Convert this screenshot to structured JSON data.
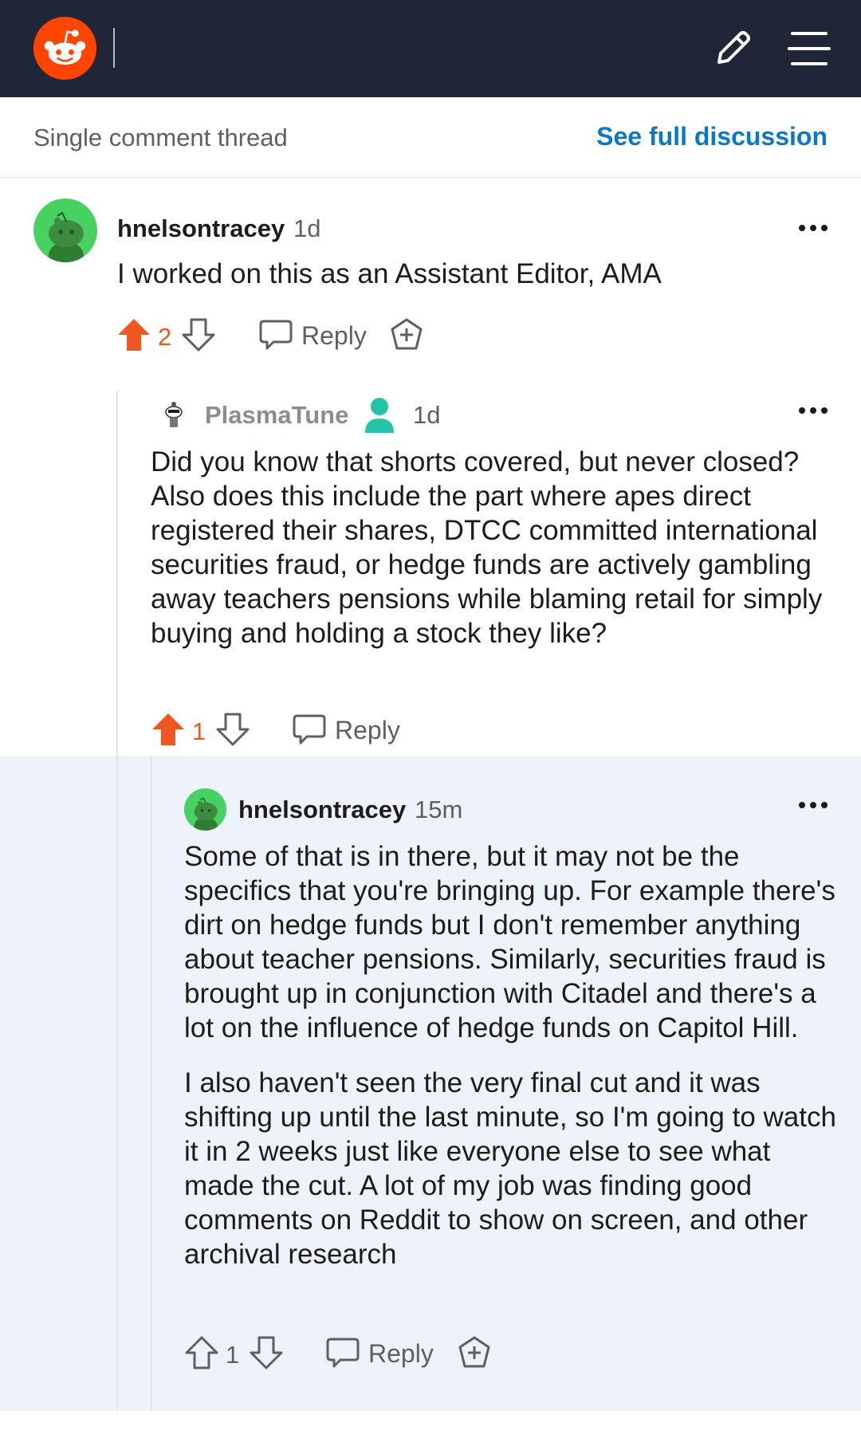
{
  "topbar": {
    "logo_icon": "reddit-snoo-logo",
    "edit_icon": "pencil-icon",
    "menu_icon": "hamburger-menu-icon",
    "colors": {
      "bar": "#1f2638",
      "logo": "#ff4500"
    }
  },
  "subheader": {
    "title": "Single comment thread",
    "link": "See full discussion"
  },
  "comments": [
    {
      "username": "hnelsontracey",
      "time": "1d",
      "paragraphs": [
        "I worked on this as an Assistant Editor, AMA"
      ],
      "score": "2",
      "vote_state": "upvoted",
      "reply_label": "Reply"
    },
    {
      "username": "PlasmaTune",
      "time": "1d",
      "paragraphs": [
        "Did you know that shorts covered, but never closed? Also does this include the part where apes direct registered their shares, DTCC committed international securities fraud, or hedge funds are actively gambling away teachers pensions while blaming retail for simply buying and holding a stock they like?"
      ],
      "score": "1",
      "vote_state": "upvoted",
      "reply_label": "Reply"
    },
    {
      "username": "hnelsontracey",
      "time": "15m",
      "paragraphs": [
        "Some of that is in there, but it may not be the specifics that you're bringing up. For example there's dirt on hedge funds but I don't remember anything about teacher pensions. Similarly, securities fraud is brought up in conjunction with Citadel and there's a lot on the influence of hedge funds on Capitol Hill.",
        "I also haven't seen the very final cut and it was shifting up until the last minute, so I'm going to watch it in 2 weeks just like everyone else to see what made the cut. A lot of my job was finding good comments on Reddit to show on screen, and other archival research"
      ],
      "score": "1",
      "vote_state": "none",
      "reply_label": "Reply"
    }
  ],
  "colors": {
    "upvote": "#f0561f",
    "link": "#0a78c7",
    "highlight_bg": "#eef3f9",
    "op_avatar_bg": "#46d160"
  }
}
